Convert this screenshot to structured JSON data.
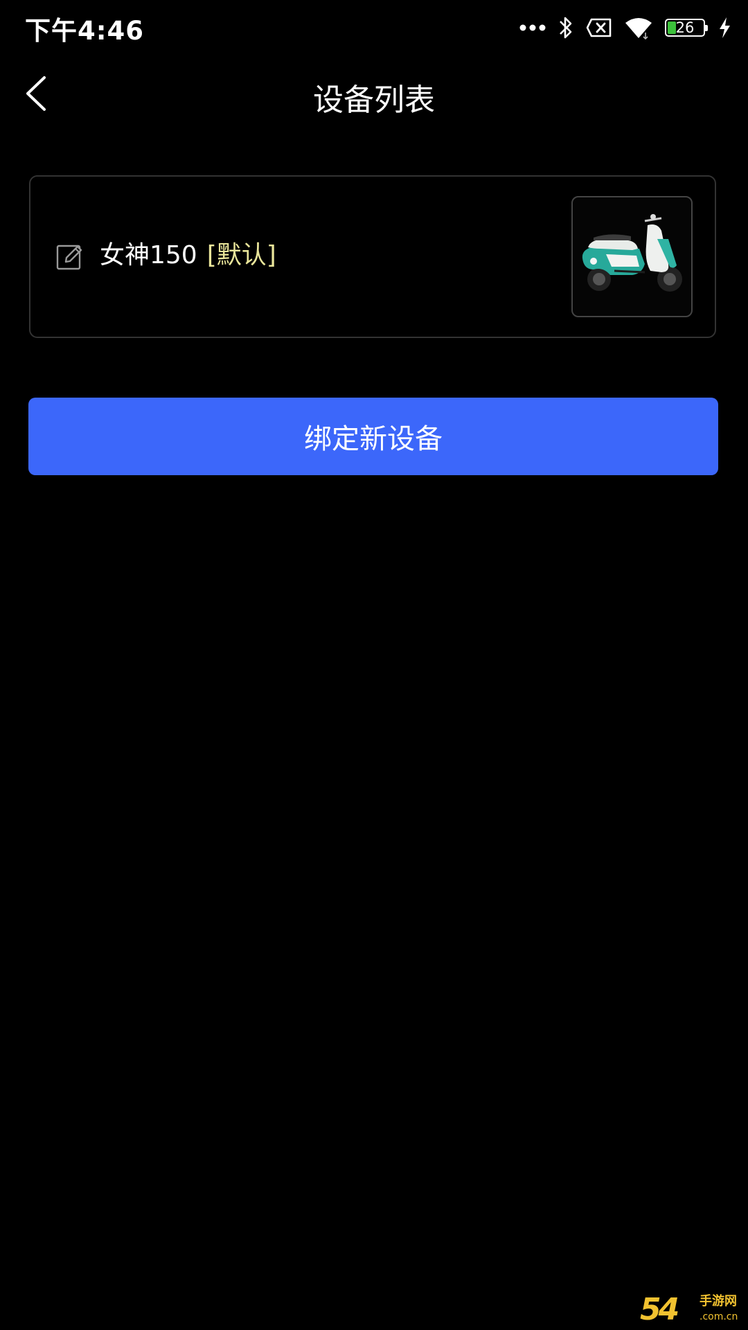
{
  "status_bar": {
    "time": "下午4:46",
    "battery_level": "26",
    "battery_fill_color": "#3cc13b",
    "icons": [
      "more-dots-icon",
      "bluetooth-icon",
      "no-sim-icon",
      "wifi-icon",
      "battery-icon",
      "charging-icon"
    ]
  },
  "header": {
    "title": "设备列表",
    "back_icon": "chevron-left-icon"
  },
  "devices": [
    {
      "name": "女神150",
      "badge": "[默认]",
      "edit_icon": "edit-icon",
      "thumbnail": "scooter-image"
    }
  ],
  "actions": {
    "bind_label": "绑定新设备",
    "bind_color": "#3c67fa"
  },
  "watermark": {
    "logo": "54",
    "text": "手游网",
    "domain": ".com.cn"
  }
}
